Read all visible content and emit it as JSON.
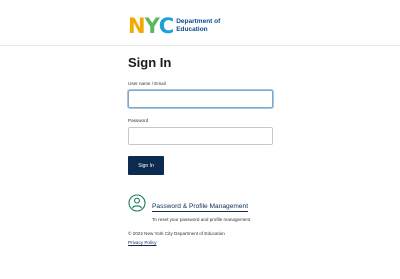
{
  "brand": {
    "logo_letters": [
      "N",
      "Y",
      "C"
    ],
    "logo_colors": [
      "#f2a900",
      "#5cb85c",
      "#1fa0d8"
    ],
    "department_line1": "Department of",
    "department_line2": "Education",
    "text_color": "#0a4b8f"
  },
  "form": {
    "title": "Sign In",
    "username_label": "User name / Email",
    "username_value": "",
    "password_label": "Password",
    "password_value": "",
    "submit_label": "Sign In",
    "button_color": "#0b2b50"
  },
  "profile_management": {
    "icon": "person-icon",
    "link_text": "Password & Profile Management",
    "description": "To reset your password and profile management"
  },
  "footer": {
    "copyright": "© 2022 New York City Department of Education",
    "privacy_link": "Privacy Policy"
  }
}
